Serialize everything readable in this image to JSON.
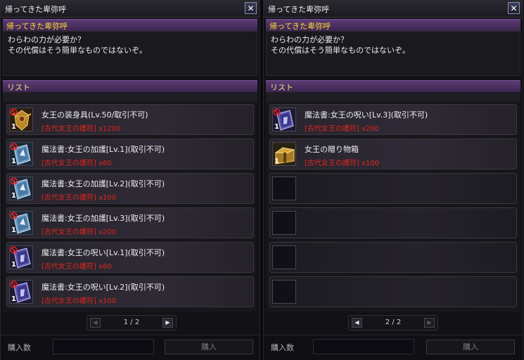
{
  "left_panel": {
    "title": "帰ってきた卑弥呼",
    "npc_name": "帰ってきた卑弥呼",
    "dialog": [
      "わらわの力が必要か？",
      "その代償はそう簡単なものではないぞ。"
    ],
    "list_label": "リスト",
    "items": [
      {
        "icon": "golden-armor-icon",
        "qty": "1",
        "name": "女王の装身具(Lv.50/取引不可)",
        "cost_name": "[古代女王の護符]",
        "cost_qty": "x1200"
      },
      {
        "icon": "blue-spellbook-icon",
        "qty": "1",
        "name": "魔法書:女王の加護[Lv.1](取引不可)",
        "cost_name": "[古代女王の護符]",
        "cost_qty": "x60"
      },
      {
        "icon": "blue-spellbook-icon",
        "qty": "1",
        "name": "魔法書:女王の加護[Lv.2](取引不可)",
        "cost_name": "[古代女王の護符]",
        "cost_qty": "x100"
      },
      {
        "icon": "blue-spellbook-icon",
        "qty": "1",
        "name": "魔法書:女王の加護[Lv.3](取引不可)",
        "cost_name": "[古代女王の護符]",
        "cost_qty": "x200"
      },
      {
        "icon": "purple-spellbook-icon",
        "qty": "1",
        "name": "魔法書:女王の呪い[Lv.1](取引不可)",
        "cost_name": "[古代女王の護符]",
        "cost_qty": "x60"
      },
      {
        "icon": "purple-spellbook-icon",
        "qty": "1",
        "name": "魔法書:女王の呪い[Lv.2](取引不可)",
        "cost_name": "[古代女王の護符]",
        "cost_qty": "x100"
      }
    ],
    "page": "1 / 2",
    "buy_label": "購入数",
    "buy_button": "購入"
  },
  "right_panel": {
    "title": "帰ってきた卑弥呼",
    "npc_name": "帰ってきた卑弥呼",
    "dialog": [
      "わらわの力が必要か？",
      "その代償はそう簡単なものではないぞ。"
    ],
    "list_label": "リスト",
    "items": [
      {
        "icon": "purple-spellbook-icon",
        "qty": "1",
        "name": "魔法書:女王の呪い[Lv.3](取引不可)",
        "cost_name": "[古代女王の護符]",
        "cost_qty": "x200"
      },
      {
        "icon": "gift-box-icon",
        "qty": "1",
        "name": "女王の贈り物箱",
        "cost_name": "[古代女王の護符]",
        "cost_qty": "x100"
      }
    ],
    "page": "2 / 2",
    "buy_label": "購入数",
    "buy_button": "購入"
  },
  "colors": {
    "npc_name": "#ffd93a",
    "cost": "#e0261f",
    "header_bar": "#4a2f60"
  }
}
